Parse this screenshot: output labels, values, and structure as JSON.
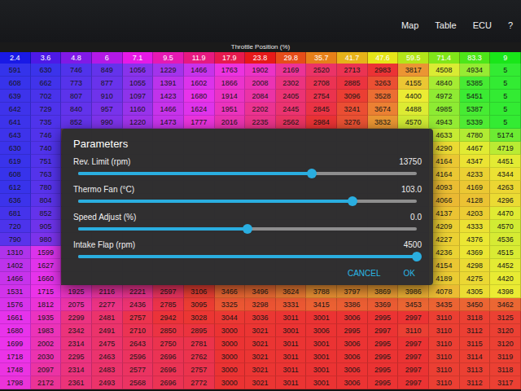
{
  "menu": [
    "Map",
    "Table",
    "ECU",
    "?"
  ],
  "table": {
    "title": "Throttle Position (%)",
    "columns": [
      "2.4",
      "3.6",
      "4.8",
      "6",
      "7.1",
      "9.5",
      "11.9",
      "17.9",
      "23.8",
      "29.8",
      "35.7",
      "41.7",
      "47.6",
      "59.5",
      "71.4",
      "83.3",
      "9"
    ],
    "rows": [
      [
        "591",
        "630",
        "746",
        "849",
        "1056",
        "1229",
        "1466",
        "1763",
        "1902",
        "2169",
        "2520",
        "2713",
        "2983",
        "3817",
        "4508",
        "4934",
        "5"
      ],
      [
        "608",
        "662",
        "773",
        "877",
        "1055",
        "1391",
        "1602",
        "1866",
        "2008",
        "2302",
        "2708",
        "2885",
        "3263",
        "4155",
        "4840",
        "5385",
        "5"
      ],
      [
        "639",
        "702",
        "807",
        "910",
        "1097",
        "1423",
        "1680",
        "1914",
        "2084",
        "2405",
        "2754",
        "3096",
        "3528",
        "4400",
        "4972",
        "5451",
        "5"
      ],
      [
        "642",
        "729",
        "840",
        "957",
        "1160",
        "1466",
        "1624",
        "1951",
        "2202",
        "2445",
        "2845",
        "3241",
        "3674",
        "4488",
        "4985",
        "5387",
        "5"
      ],
      [
        "641",
        "735",
        "852",
        "990",
        "1220",
        "1473",
        "1777",
        "2016",
        "2235",
        "2562",
        "2984",
        "3276",
        "3832",
        "4570",
        "4943",
        "5339",
        "5"
      ],
      [
        "643",
        "746",
        "",
        "",
        "",
        "",
        "",
        "",
        "",
        "",
        "",
        "",
        "",
        "",
        "4633",
        "4780",
        "5174"
      ],
      [
        "630",
        "740",
        "",
        "",
        "",
        "",
        "",
        "",
        "",
        "",
        "",
        "",
        "",
        "",
        "4290",
        "4467",
        "4719"
      ],
      [
        "619",
        "751",
        "",
        "",
        "",
        "",
        "",
        "",
        "",
        "",
        "",
        "",
        "",
        "",
        "4164",
        "4347",
        "4451"
      ],
      [
        "608",
        "763",
        "",
        "",
        "",
        "",
        "",
        "",
        "",
        "",
        "",
        "",
        "",
        "",
        "4164",
        "4233",
        "4344"
      ],
      [
        "612",
        "780",
        "",
        "",
        "",
        "",
        "",
        "",
        "",
        "",
        "",
        "",
        "",
        "",
        "4093",
        "4169",
        "4263"
      ],
      [
        "636",
        "804",
        "",
        "",
        "",
        "",
        "",
        "",
        "",
        "",
        "",
        "",
        "",
        "",
        "4066",
        "4128",
        "4296"
      ],
      [
        "681",
        "852",
        "",
        "",
        "",
        "",
        "",
        "",
        "",
        "",
        "",
        "",
        "",
        "",
        "4137",
        "4203",
        "4470"
      ],
      [
        "720",
        "905",
        "",
        "",
        "",
        "",
        "",
        "",
        "",
        "",
        "",
        "",
        "",
        "",
        "4209",
        "4333",
        "4570"
      ],
      [
        "790",
        "980",
        "",
        "",
        "",
        "",
        "",
        "",
        "",
        "",
        "",
        "",
        "",
        "",
        "4227",
        "4376",
        "4536"
      ],
      [
        "1310",
        "1599",
        "",
        "",
        "",
        "",
        "",
        "",
        "",
        "",
        "",
        "",
        "",
        "",
        "4236",
        "4369",
        "4515"
      ],
      [
        "1402",
        "1627",
        "",
        "",
        "",
        "",
        "",
        "",
        "",
        "",
        "",
        "",
        "",
        "",
        "4154",
        "4298",
        "4452"
      ],
      [
        "1466",
        "1660",
        "",
        "",
        "",
        "",
        "",
        "",
        "",
        "",
        "",
        "",
        "",
        "",
        "4189",
        "4275",
        "4420"
      ],
      [
        "1531",
        "1715",
        "1925",
        "2116",
        "2221",
        "2597",
        "3106",
        "3466",
        "3496",
        "3624",
        "3788",
        "3797",
        "3869",
        "3986",
        "4078",
        "4305",
        "4398"
      ],
      [
        "1576",
        "1812",
        "2075",
        "2277",
        "2436",
        "2785",
        "3095",
        "3325",
        "3298",
        "3331",
        "3415",
        "3386",
        "3369",
        "3453",
        "3435",
        "3450",
        "3462"
      ],
      [
        "1661",
        "1935",
        "2299",
        "2481",
        "2757",
        "2942",
        "3028",
        "3044",
        "3036",
        "3011",
        "3001",
        "3006",
        "2995",
        "2997",
        "3110",
        "3118",
        "3125"
      ],
      [
        "1680",
        "1983",
        "2342",
        "2491",
        "2710",
        "2850",
        "2895",
        "3000",
        "3021",
        "3001",
        "3006",
        "2995",
        "2997",
        "3110",
        "3110",
        "3112",
        "3120"
      ],
      [
        "1699",
        "2002",
        "2314",
        "2475",
        "2643",
        "2750",
        "2781",
        "3000",
        "3021",
        "3011",
        "3001",
        "3006",
        "2995",
        "2997",
        "3110",
        "3115",
        "3120"
      ],
      [
        "1718",
        "2030",
        "2295",
        "2463",
        "2596",
        "2696",
        "2762",
        "3000",
        "3021",
        "3011",
        "3001",
        "3006",
        "2995",
        "2997",
        "3110",
        "3114",
        "3119"
      ],
      [
        "1748",
        "2097",
        "2314",
        "2483",
        "2577",
        "2696",
        "2757",
        "3000",
        "3021",
        "3011",
        "3001",
        "3006",
        "2995",
        "2997",
        "3110",
        "3113",
        "3118"
      ],
      [
        "1798",
        "2172",
        "2361",
        "2493",
        "2568",
        "2696",
        "2772",
        "3000",
        "3021",
        "3011",
        "3001",
        "3006",
        "2995",
        "2997",
        "3110",
        "3112",
        "3117"
      ]
    ]
  },
  "dialog": {
    "title": "Parameters",
    "sliders": [
      {
        "label": "Rev. Limit (rpm)",
        "reading": "13750",
        "level": 0.69
      },
      {
        "label": "Thermo Fan (°C)",
        "reading": "103.0",
        "level": 0.81
      },
      {
        "label": "Speed Adjust (%)",
        "reading": "0.0",
        "level": 0.5
      },
      {
        "label": "Intake Flap (rpm)",
        "reading": "4500",
        "level": 1.0
      }
    ],
    "buttons": [
      "CANCEL",
      "OK"
    ]
  }
}
